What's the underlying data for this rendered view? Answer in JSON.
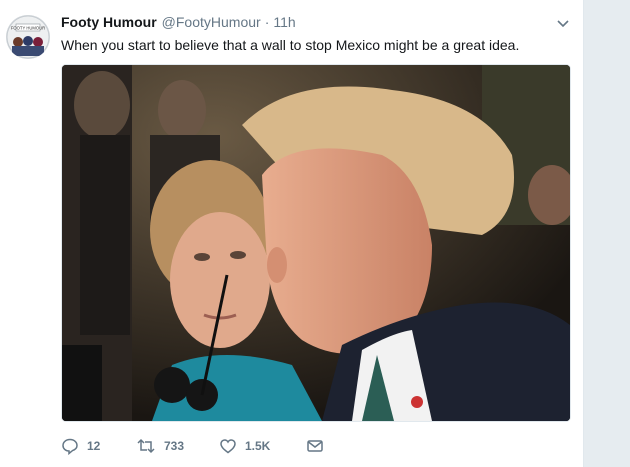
{
  "tweet": {
    "author": {
      "display_name": "Footy Humour",
      "handle": "@FootyHumour",
      "avatar_label": "FOOTY HUMOUR"
    },
    "separator": "·",
    "time": "11h",
    "text": "When you start to believe that a wall to stop Mexico might be a great idea.",
    "media": {
      "kind": "photo"
    },
    "actions": {
      "reply_count": "12",
      "retweet_count": "733",
      "like_count": "1.5K"
    }
  },
  "colors": {
    "text": "#14171a",
    "secondary": "#657786",
    "background": "#e6ecf0",
    "card": "#ffffff"
  },
  "icons": [
    "caret-down-icon",
    "reply-icon",
    "retweet-icon",
    "like-icon",
    "message-icon"
  ]
}
